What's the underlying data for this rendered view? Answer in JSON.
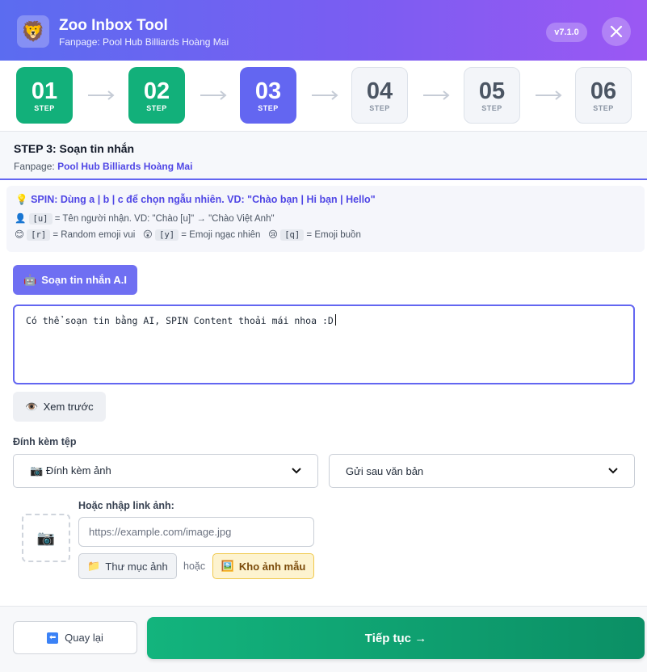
{
  "header": {
    "title": "Zoo Inbox Tool",
    "subtitle": "Fanpage: Pool Hub Billiards Hoàng Mai",
    "version": "v7.1.0",
    "logo_icon": "lion-face-icon",
    "close_icon": "close-icon"
  },
  "steps": [
    {
      "num": "01",
      "label": "STEP",
      "state": "done"
    },
    {
      "num": "02",
      "label": "STEP",
      "state": "done"
    },
    {
      "num": "03",
      "label": "STEP",
      "state": "active"
    },
    {
      "num": "04",
      "label": "STEP",
      "state": "todo"
    },
    {
      "num": "05",
      "label": "STEP",
      "state": "todo"
    },
    {
      "num": "06",
      "label": "STEP",
      "state": "todo"
    }
  ],
  "section": {
    "title": "STEP 3: Soạn tin nhắn",
    "fanpage_prefix": "Fanpage:",
    "fanpage_name": "Pool Hub Billiards Hoàng Mai"
  },
  "spin_help": {
    "line1": "SPIN: Dùng a | b | c để chọn ngẫu nhiên. VD: \"Chào bạn | Hi bạn | Hello\"",
    "u_code": "[u]",
    "u_text": "= Tên người nhận. VD: \"Chào [u]\" → \"Chào Việt Anh\"",
    "r_code": "[r]",
    "r_text": "= Random emoji vui",
    "y_code": "[y]",
    "y_text": "= Emoji ngạc nhiên",
    "q_code": "[q]",
    "q_text": "= Emoji buồn"
  },
  "compose": {
    "ai_button": "Soạn tin nhắn A.I",
    "message": "Có thể soạn tin bằng AI, SPIN Content thoải mái nhoa :D",
    "preview_button": "Xem trước"
  },
  "attachment": {
    "label": "Đính kèm tệp",
    "type_selected": "Đính kèm ảnh",
    "order_selected": "Gửi sau văn bản",
    "link_label": "Hoặc nhập link ảnh:",
    "link_placeholder": "https://example.com/image.jpg",
    "folder_button": "Thư mục ảnh",
    "or_text": "hoặc",
    "gallery_button": "Kho ảnh mẫu"
  },
  "footer": {
    "back_button": "Quay lại",
    "next_button": "Tiếp tục →"
  },
  "colors": {
    "accent": "#6366f1",
    "success": "#12b07a"
  }
}
